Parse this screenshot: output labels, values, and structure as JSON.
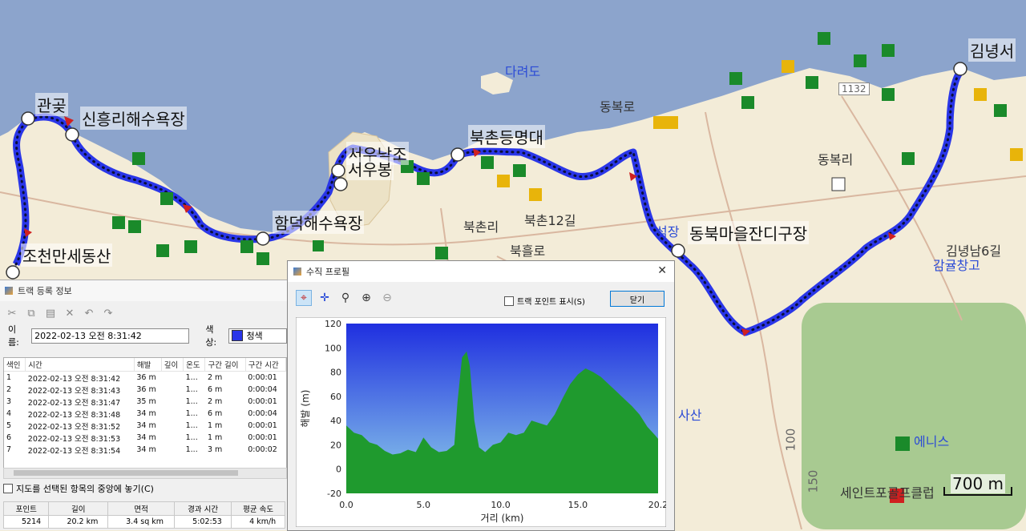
{
  "map": {
    "scale_label": "700 m",
    "labels": {
      "gwangot": "관곶",
      "sinheung_beach": "신흥리해수욕장",
      "jocheon_sedongsan": "조천만세동산",
      "seounakjo": "서우낙조",
      "seoubong": "서우봉",
      "hamdeok_beach": "함덕해수욕장",
      "bukchon_deungmyeong": "북촌등명대",
      "dongbok_ro": "동복로",
      "dongbok_ri": "동복리",
      "bukchon_ri": "북촌리",
      "bukchon_12gil": "북촌12길",
      "bukheul_ro": "북흘로",
      "dongbuk_maeul": "동북마을잔디구장",
      "seokjang": "석장",
      "gimnyeong": "김녕서",
      "gimnyeongnam6": "김녕남6길",
      "gamgyu": "감귤창고",
      "dareodo": "다려도",
      "enice": "에니스",
      "saint": "세인트포골프클럽",
      "sasan": "사산",
      "road_1132": "1132",
      "contour_100": "100",
      "contour_150": "150"
    }
  },
  "track_panel": {
    "title": "트랙 등록 정보",
    "name_label": "이름:",
    "name_value": "2022-02-13 오전 8:31:42",
    "color_label": "색상:",
    "color_value": "청색",
    "columns": [
      "색인",
      "시간",
      "해발",
      "깊이",
      "온도",
      "구간 길이",
      "구간 시간"
    ],
    "rows": [
      [
        "1",
        "2022-02-13 오전 8:31:42",
        "36 m",
        "",
        "1...",
        "2 m",
        "0:00:01"
      ],
      [
        "2",
        "2022-02-13 오전 8:31:43",
        "36 m",
        "",
        "1...",
        "6 m",
        "0:00:04"
      ],
      [
        "3",
        "2022-02-13 오전 8:31:47",
        "35 m",
        "",
        "1...",
        "2 m",
        "0:00:01"
      ],
      [
        "4",
        "2022-02-13 오전 8:31:48",
        "34 m",
        "",
        "1...",
        "6 m",
        "0:00:04"
      ],
      [
        "5",
        "2022-02-13 오전 8:31:52",
        "34 m",
        "",
        "1...",
        "1 m",
        "0:00:01"
      ],
      [
        "6",
        "2022-02-13 오전 8:31:53",
        "34 m",
        "",
        "1...",
        "1 m",
        "0:00:01"
      ],
      [
        "7",
        "2022-02-13 오전 8:31:54",
        "34 m",
        "",
        "1...",
        "3 m",
        "0:00:02"
      ]
    ],
    "center_checkbox": "지도를 선택된 항목의 중앙에 놓기(C)",
    "summary_headers": [
      "포인트",
      "길이",
      "면적",
      "경과 시간",
      "평균 속도"
    ],
    "summary_values": [
      "5214",
      "20.2 km",
      "3.4 sq km",
      "5:02:53",
      "4 km/h"
    ]
  },
  "profile_dialog": {
    "title": "수직 프로필",
    "close_x": "✕",
    "show_points_label": "트랙 포인트 표시(S)",
    "close_button": "닫기"
  },
  "colors": {
    "track": "#2a36e8",
    "sea": "#8ca4cc",
    "land": "#f3ecd8",
    "profile_fill": "#1f9a2e",
    "profile_sky_top": "#1f2fe0"
  },
  "chart_data": {
    "type": "area",
    "title": "",
    "xlabel": "거리 (km)",
    "ylabel": "해발 (m)",
    "xlim": [
      0,
      20.2
    ],
    "ylim": [
      -20,
      120
    ],
    "xticks": [
      "0.0",
      "5.0",
      "10.0",
      "15.0",
      "20.2"
    ],
    "yticks": [
      "120",
      "100",
      "80",
      "60",
      "40",
      "20",
      "0",
      "-20"
    ],
    "x": [
      0,
      0.5,
      1,
      1.5,
      2,
      2.5,
      3,
      3.5,
      4,
      4.5,
      5,
      5.5,
      6,
      6.5,
      7,
      7.2,
      7.5,
      7.8,
      8,
      8.3,
      8.6,
      9,
      9.5,
      10,
      10.5,
      11,
      11.5,
      12,
      12.5,
      13,
      13.5,
      14,
      14.5,
      15,
      15.5,
      16,
      16.5,
      17,
      17.5,
      18,
      18.5,
      19,
      19.5,
      20,
      20.2
    ],
    "values": [
      36,
      30,
      28,
      22,
      20,
      15,
      12,
      13,
      16,
      14,
      26,
      18,
      14,
      15,
      20,
      55,
      92,
      97,
      85,
      40,
      18,
      14,
      20,
      22,
      30,
      28,
      30,
      40,
      38,
      36,
      45,
      58,
      70,
      78,
      83,
      80,
      76,
      70,
      64,
      58,
      52,
      45,
      35,
      28,
      25
    ]
  }
}
